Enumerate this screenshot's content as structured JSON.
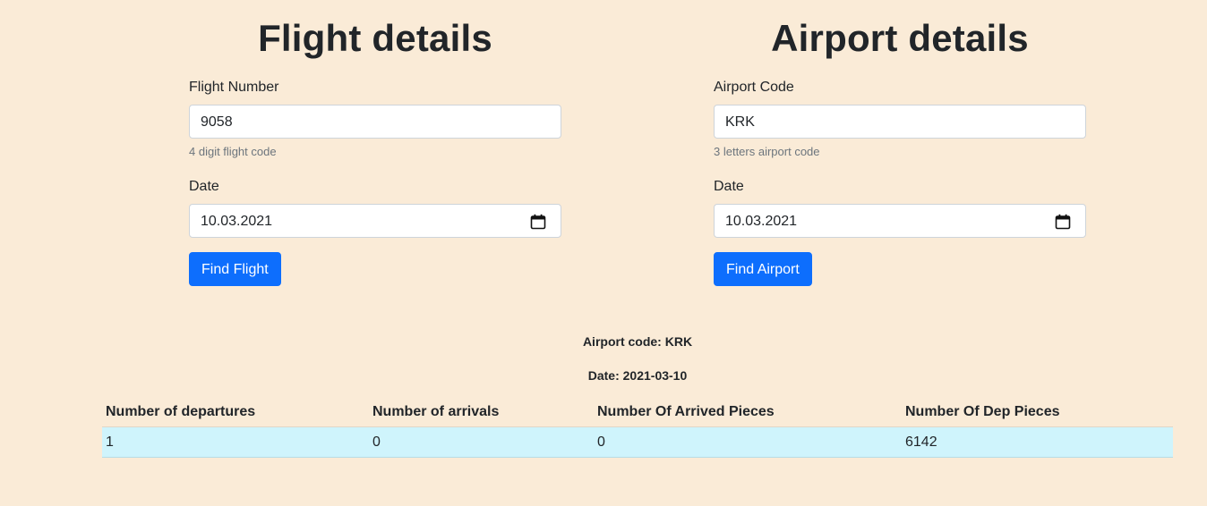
{
  "flight": {
    "title": "Flight details",
    "number_label": "Flight Number",
    "number_value": "9058",
    "number_help": "4 digit flight code",
    "date_label": "Date",
    "date_value": "10.03.2021",
    "button_label": "Find Flight"
  },
  "airport": {
    "title": "Airport details",
    "code_label": "Airport Code",
    "code_value": "KRK",
    "code_help": "3 letters airport code",
    "date_label": "Date",
    "date_value": "10.03.2021",
    "button_label": "Find Airport"
  },
  "summary": {
    "airport_code_line": "Airport code: KRK",
    "date_line": "Date: 2021-03-10"
  },
  "table": {
    "headers": [
      "Number of departures",
      "Number of arrivals",
      "Number Of Arrived Pieces",
      "Number Of Dep Pieces"
    ],
    "rows": [
      [
        "1",
        "0",
        "0",
        "6142"
      ]
    ]
  },
  "colors": {
    "page_background": "#faebd7",
    "primary_button": "#0d6efd",
    "row_highlight": "#cff4fc"
  },
  "icons": {
    "date_picker": "calendar-icon"
  }
}
